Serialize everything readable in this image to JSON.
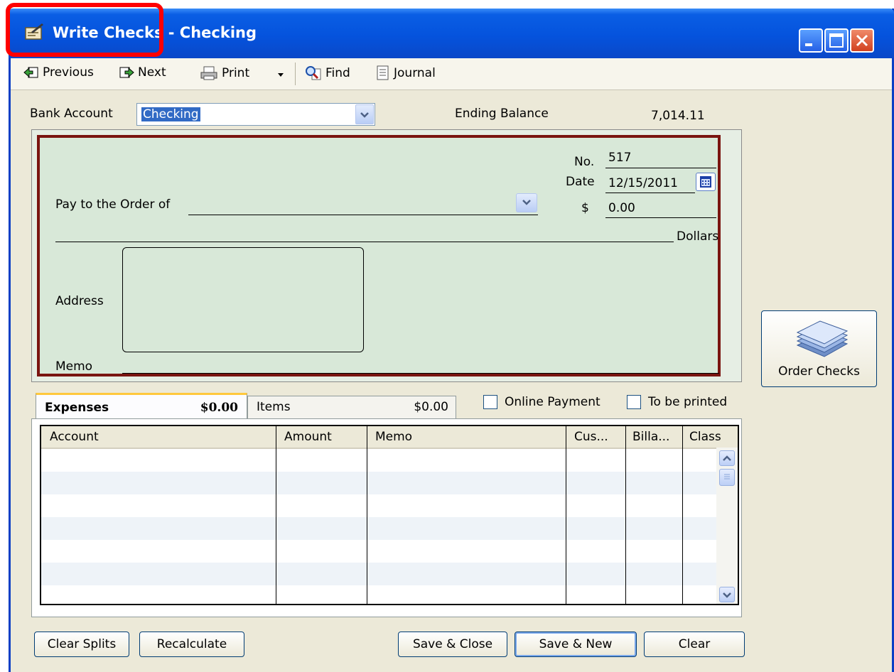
{
  "window": {
    "title_main": "Write Checks",
    "title_rest": " - Checking"
  },
  "toolbar": {
    "previous_label": "Previous",
    "next_label": "Next",
    "print_label": "Print",
    "find_label": "Find",
    "journal_label": "Journal"
  },
  "account": {
    "bank_account_label": "Bank Account",
    "bank_account_value": "Checking",
    "ending_balance_label": "Ending Balance",
    "ending_balance_value": "7,014.11"
  },
  "check": {
    "no_label": "No.",
    "no_value": "517",
    "date_label": "Date",
    "date_value": "12/15/2011",
    "pay_to_label": "Pay to the Order of",
    "pay_to_value": "",
    "dollar_sign": "$",
    "amount_value": "0.00",
    "dollars_label": "Dollars",
    "address_label": "Address",
    "memo_label": "Memo"
  },
  "tabs": [
    {
      "label": "Expenses",
      "amount": "$0.00",
      "active": true
    },
    {
      "label": "Items",
      "amount": "$0.00",
      "active": false
    }
  ],
  "options": {
    "online_payment_label": "Online Payment",
    "online_payment_checked": false,
    "to_be_printed_label": "To be printed",
    "to_be_printed_checked": false
  },
  "grid": {
    "columns": [
      "Account",
      "Amount",
      "Memo",
      "Cus...",
      "Billa...",
      "Class"
    ]
  },
  "order_checks_label": "Order Checks",
  "buttons": {
    "clear_splits": "Clear Splits",
    "recalculate": "Recalculate",
    "save_close": "Save & Close",
    "save_new": "Save & New",
    "clear": "Clear"
  },
  "colors": {
    "titlebar": "#0553dd",
    "check_background": "#d8e8d8",
    "check_border": "#7a1410",
    "highlight": "#ff0000"
  }
}
